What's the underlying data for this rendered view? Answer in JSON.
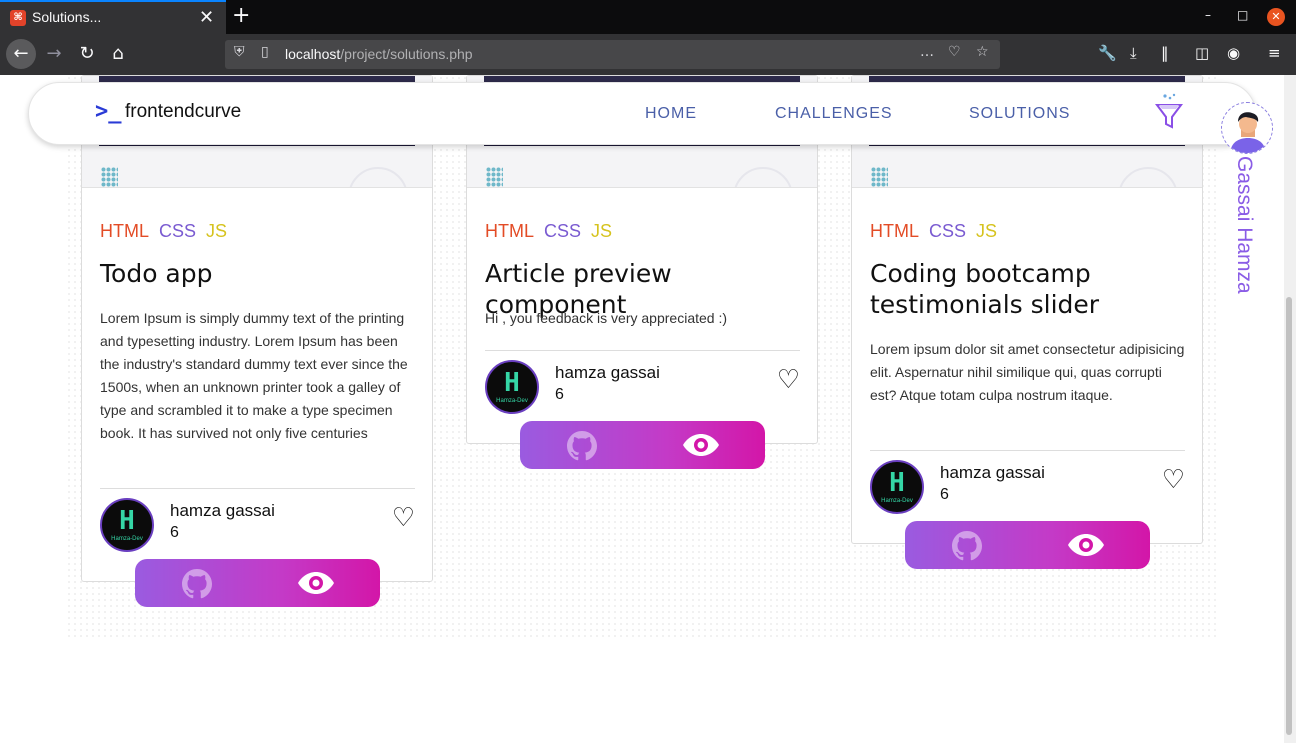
{
  "browser": {
    "tab_title": "Solutions...",
    "url_host": "localhost",
    "url_path": "/project/solutions.php"
  },
  "header": {
    "logo_mark": ">_",
    "logo_text": "frontendcurve",
    "nav": [
      "HOME",
      "CHALLENGES",
      "SOLUTIONS"
    ]
  },
  "cards": [
    {
      "tags": [
        "HTML",
        "CSS",
        "JS"
      ],
      "title": "Todo app",
      "description": "Lorem Ipsum is simply dummy text of the printing and typesetting industry. Lorem Ipsum has been the industry's standard dummy text ever since the 1500s, when an unknown printer took a galley of type and scrambled it to make a type specimen book. It has survived not only five centuries",
      "author": "hamza gassai",
      "likes": "6"
    },
    {
      "tags": [
        "HTML",
        "CSS",
        "JS"
      ],
      "title": "Article preview component",
      "description": "Hi , you feedback is very appreciated :)",
      "author": "hamza gassai",
      "likes": "6"
    },
    {
      "tags": [
        "HTML",
        "CSS",
        "JS"
      ],
      "title": "Coding bootcamp testimonials slider",
      "description": "Lorem ipsum dolor sit amet consectetur adipisicing elit. Aspernatur nihil similique qui, quas corrupti est? Atque totam culpa nostrum itaque.",
      "author": "hamza gassai",
      "likes": "6"
    }
  ],
  "avatar_label": "Hamza-Dev",
  "profile": {
    "name": "Gassai Hamza"
  },
  "colors": {
    "html": "#e34c26",
    "css": "#7a5bd1",
    "js": "#d6c31f",
    "accent": "#c43ac7"
  }
}
